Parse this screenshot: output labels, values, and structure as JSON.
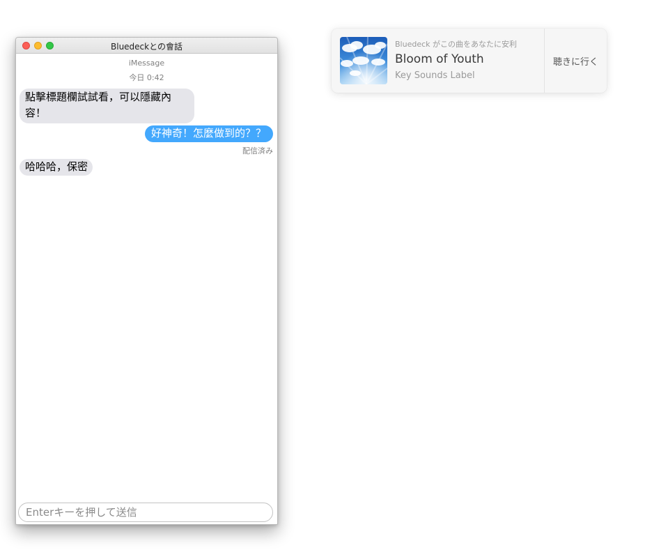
{
  "window": {
    "title": "Bluedeckとの會話",
    "service": "iMessage",
    "timestamp": "今日 0:42"
  },
  "messages": [
    {
      "direction": "received",
      "text": "點擊標題欄試試看，可以隱藏內容！"
    },
    {
      "direction": "sent",
      "text": "好神奇！怎麼做到的？？"
    },
    {
      "direction": "received",
      "text": "哈哈哈，保密"
    }
  ],
  "delivery_status": "配信済み",
  "composer": {
    "placeholder": "Enterキーを押して送信",
    "value": ""
  },
  "notification": {
    "app_line": "Bluedeck がこの曲をあなたに安利",
    "song_title": "Bloom of Youth",
    "artist": "Key Sounds Label",
    "action_label": "聴きに行く"
  },
  "colors": {
    "sent_bubble": "#43a8fd",
    "received_bubble": "#e5e5ea",
    "close_light": "#fc5f57",
    "minimize_light": "#fdbc2e",
    "zoom_light": "#33c748"
  },
  "icons": {
    "album_art": "sky-clouds-album-art"
  }
}
